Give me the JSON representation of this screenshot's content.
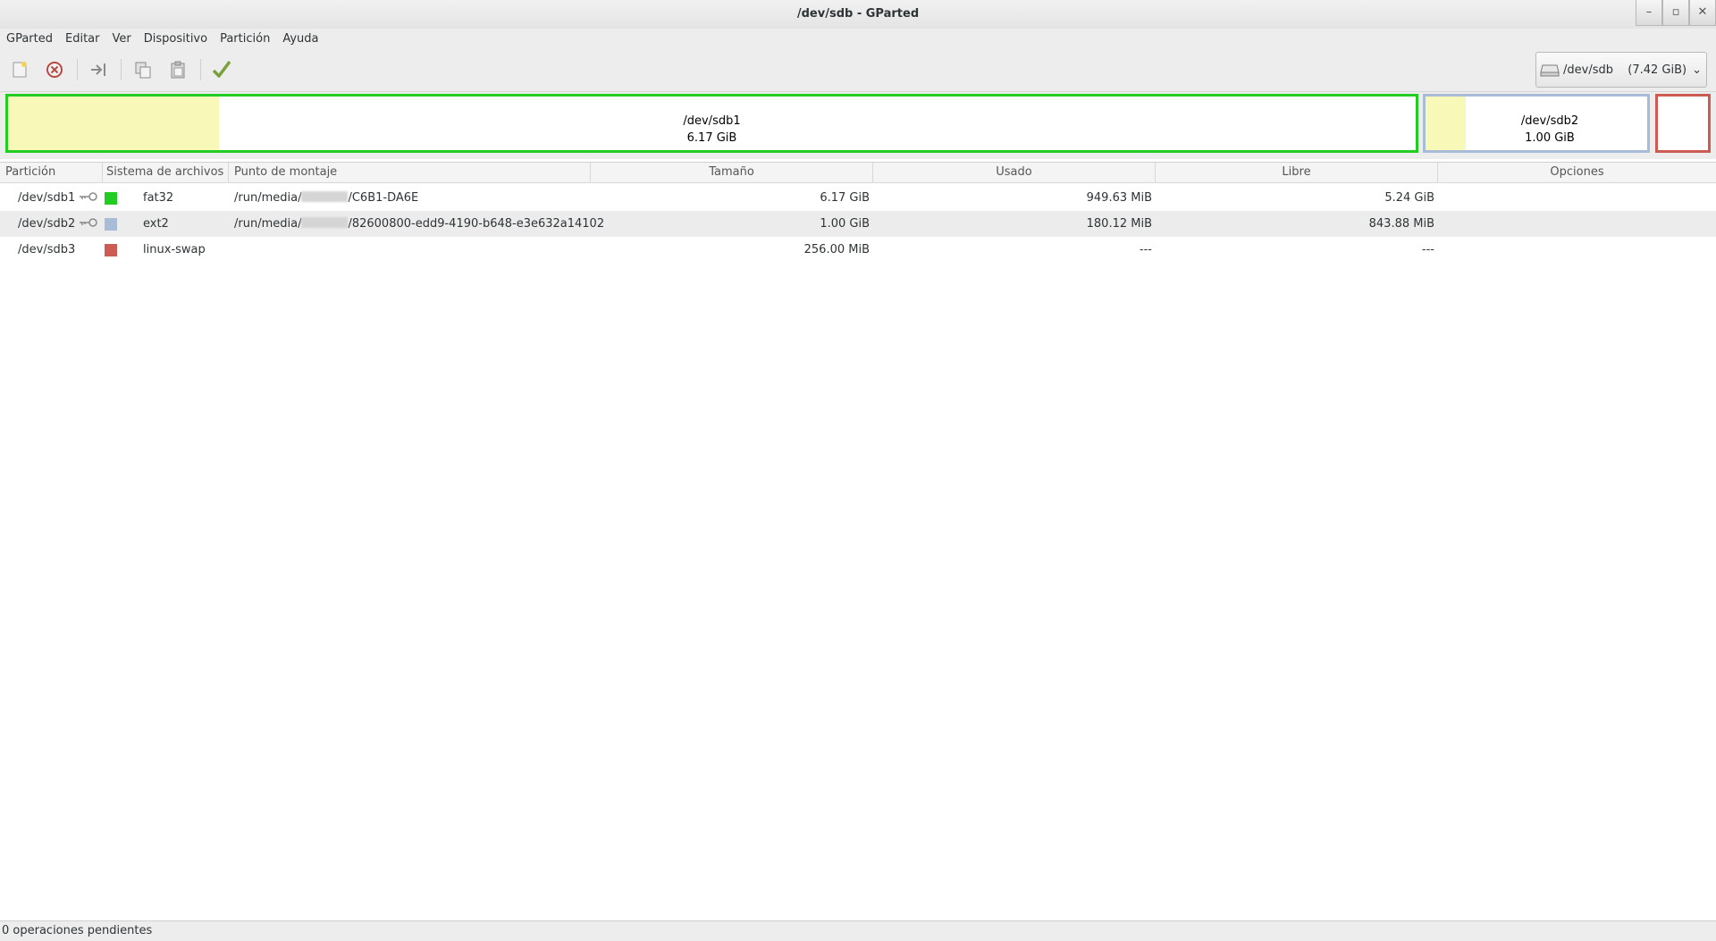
{
  "window": {
    "title": "/dev/sdb - GParted"
  },
  "menu": [
    "GParted",
    "Editar",
    "Ver",
    "Dispositivo",
    "Partición",
    "Ayuda"
  ],
  "toolbar": {
    "icons": [
      "new-icon",
      "delete-icon",
      "resize-move-icon",
      "copy-icon",
      "paste-icon",
      "apply-icon"
    ]
  },
  "device": {
    "name": "/dev/sdb",
    "size": "(7.42 GiB)"
  },
  "graph": {
    "partitions": [
      {
        "name": "/dev/sdb1",
        "size": "6.17 GiB",
        "color": "#22cc22",
        "used_fraction": 0.15
      },
      {
        "name": "/dev/sdb2",
        "size": "1.00 GiB",
        "color": "#a8bcd8",
        "used_fraction": 0.18
      },
      {
        "name": "",
        "size": "",
        "color": "#cc5b54",
        "used_fraction": 0
      }
    ]
  },
  "table": {
    "headers": [
      "Partición",
      "Sistema de archivos",
      "Punto de montaje",
      "Tamaño",
      "Usado",
      "Libre",
      "Opciones"
    ],
    "rows": [
      {
        "partition": "/dev/sdb1",
        "fs": "fat32",
        "fs_color": "#22cc22",
        "mount_prefix": "/run/media/",
        "mount_suffix": "/C6B1-DA6E",
        "size": "6.17 GiB",
        "used": "949.63 MiB",
        "free": "5.24 GiB",
        "mounted": true
      },
      {
        "partition": "/dev/sdb2",
        "fs": "ext2",
        "fs_color": "#a8bcd8",
        "mount_prefix": "/run/media/",
        "mount_suffix": "/82600800-edd9-4190-b648-e3e632a14102",
        "size": "1.00 GiB",
        "used": "180.12 MiB",
        "free": "843.88 MiB",
        "mounted": true
      },
      {
        "partition": "/dev/sdb3",
        "fs": "linux-swap",
        "fs_color": "#cc5b54",
        "mount_prefix": "",
        "mount_suffix": "",
        "size": "256.00 MiB",
        "used": "---",
        "free": "---",
        "mounted": false
      }
    ]
  },
  "status": {
    "text": "0 operaciones pendientes"
  }
}
